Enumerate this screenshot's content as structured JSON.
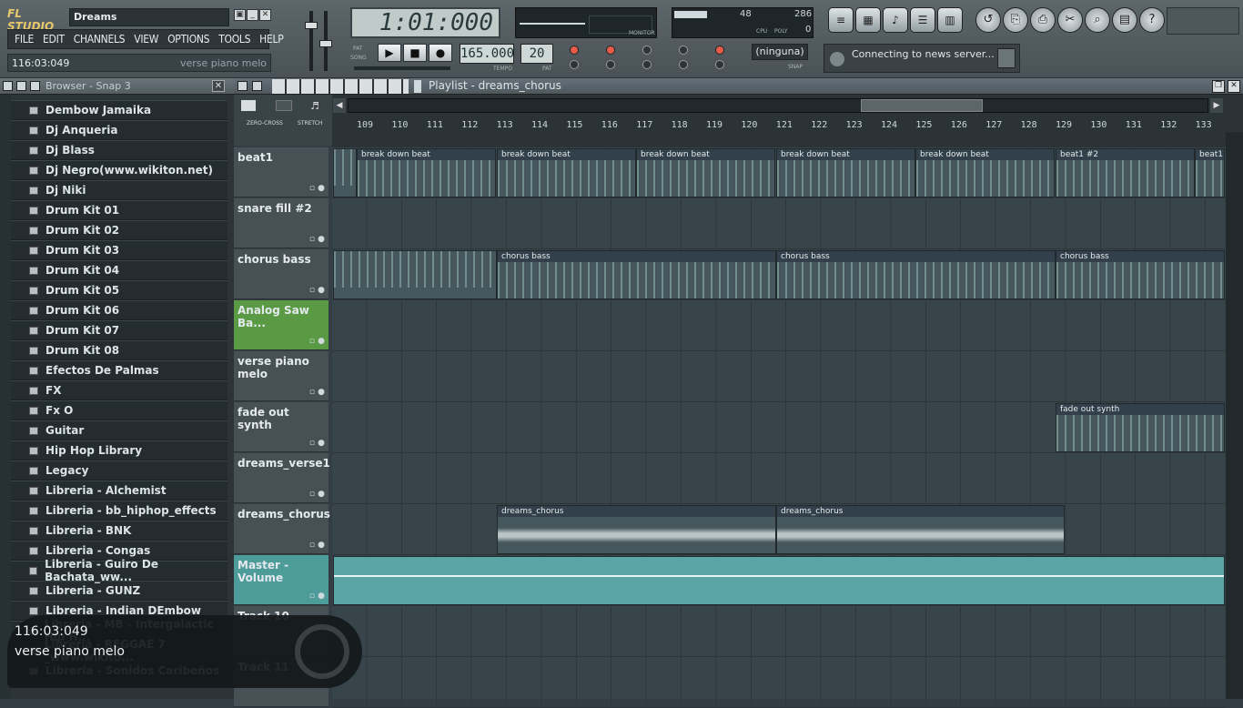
{
  "app": {
    "logo": "FL STUDIO",
    "song_name": "Dreams"
  },
  "window_buttons": [
    "▣",
    "_",
    "✕"
  ],
  "menu": [
    "FILE",
    "EDIT",
    "CHANNELS",
    "VIEW",
    "OPTIONS",
    "TOOLS",
    "HELP"
  ],
  "hint": {
    "time": "116:03:049",
    "text": "verse piano melo"
  },
  "transport": {
    "time": "1:01:000",
    "pat_label": "PAT",
    "song_label": "SONG",
    "tempo": "165.000",
    "tempo_label": "TEMPO",
    "pattern": "20",
    "pattern_label": "PAT",
    "play": "▶",
    "stop": "■",
    "record": "●"
  },
  "cpu": {
    "mem": "48",
    "poly": "286",
    "cpu_label": "CPU",
    "poly_label": "POLY",
    "voices": "0"
  },
  "scope_label": "MONITOR",
  "midi_device": "(ninguna)",
  "snap_label": "SNAP",
  "news": "Connecting to news server...",
  "browser": {
    "title": "Browser - Snap 3",
    "items": [
      "Dembow Jamaika",
      "Dj Anqueria",
      "Dj Blass",
      "Dj Negro(www.wikiton.net)",
      "Dj Niki",
      "Drum Kit 01",
      "Drum Kit 02",
      "Drum Kit 03",
      "Drum Kit 04",
      "Drum Kit 05",
      "Drum Kit 06",
      "Drum Kit 07",
      "Drum Kit 08",
      "Efectos De Palmas",
      "FX",
      "Fx O",
      "Guitar",
      "Hip Hop Library",
      "Legacy",
      "Libreria - Alchemist",
      "Libreria - bb_hiphop_effects",
      "Libreria - BNK",
      "Libreria - Congas",
      "Libreria - Guiro De Bachata_ww...",
      "Libreria - GUNZ",
      "Libreria - Indian DEmbow",
      "Libreria - MB - Intergalactic Hip H...",
      "Libreria - REGGAE 7 _www.wikito...",
      "Libreria - Sonidos Caribeños"
    ]
  },
  "playlist": {
    "title": "Playlist - dreams_chorus",
    "zero_cross": "ZERO-CROSS",
    "stretch": "STRETCH",
    "bars": [
      "109",
      "110",
      "111",
      "112",
      "113",
      "114",
      "115",
      "116",
      "117",
      "118",
      "119",
      "120",
      "121",
      "122",
      "123",
      "124",
      "125",
      "126",
      "127",
      "128",
      "129",
      "130",
      "131",
      "132",
      "133"
    ],
    "tracks": [
      {
        "name": "beat1"
      },
      {
        "name": "snare fill #2"
      },
      {
        "name": "chorus bass"
      },
      {
        "name": "Analog Saw Ba..."
      },
      {
        "name": "verse piano melo"
      },
      {
        "name": "fade out synth"
      },
      {
        "name": "dreams_verse1"
      },
      {
        "name": "dreams_chorus"
      },
      {
        "name": "Master - Volume"
      }
    ],
    "clips": {
      "beat1": [
        "break down beat",
        "break down beat",
        "break down beat",
        "break down beat",
        "break down beat",
        "beat1 #2",
        "beat1..."
      ],
      "chorus_bass": [
        "chorus bass",
        "chorus bass",
        "chorus bass"
      ],
      "fade_out_synth": [
        "fade out synth"
      ],
      "dreams_chorus": [
        "dreams_chorus",
        "dreams_chorus"
      ]
    },
    "extra_tracks": [
      "Track 10",
      "Track 11"
    ]
  },
  "osd": {
    "line1": "116:03:049",
    "line2": "verse piano melo"
  }
}
